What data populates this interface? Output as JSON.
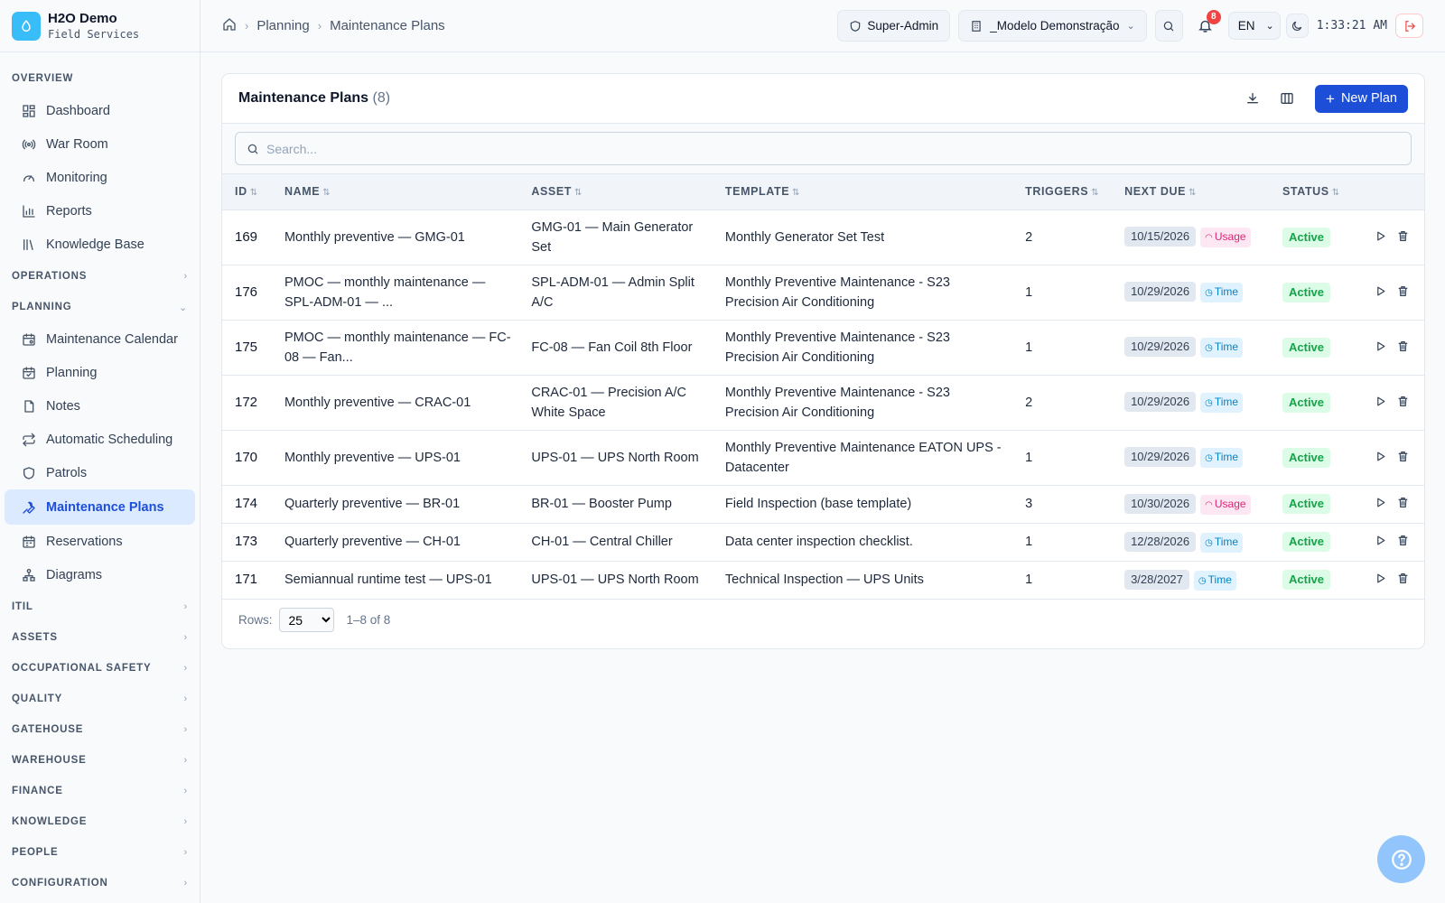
{
  "brand": {
    "title": "H2O Demo",
    "subtitle": "Field Services",
    "logo_icon": "droplet-icon"
  },
  "sidebar": {
    "overview_label": "OVERVIEW",
    "overview_items": [
      "Dashboard",
      "War Room",
      "Monitoring",
      "Reports",
      "Knowledge Base"
    ],
    "operations_label": "OPERATIONS",
    "planning_label": "PLANNING",
    "planning_items": [
      "Maintenance Calendar",
      "Planning",
      "Notes",
      "Automatic Scheduling",
      "Patrols",
      "Maintenance Plans",
      "Reservations",
      "Diagrams"
    ],
    "active_item": "Maintenance Plans",
    "collapsed_sections": [
      "ITIL",
      "ASSETS",
      "OCCUPATIONAL SAFETY",
      "QUALITY",
      "GATEHOUSE",
      "WAREHOUSE",
      "FINANCE",
      "KNOWLEDGE",
      "PEOPLE",
      "CONFIGURATION"
    ]
  },
  "header": {
    "breadcrumb": [
      "Planning",
      "Maintenance Plans"
    ],
    "role": "Super-Admin",
    "tenant": "_Modelo Demonstração",
    "notifications": "8",
    "language": "EN",
    "time": "1:33:21 AM"
  },
  "card": {
    "title": "Maintenance Plans",
    "count": "(8)",
    "new_label": "New Plan",
    "search_placeholder": "Search...",
    "columns": [
      "ID",
      "NAME",
      "ASSET",
      "TEMPLATE",
      "TRIGGERS",
      "NEXT DUE",
      "STATUS"
    ],
    "rows": [
      {
        "id": "169",
        "name": "Monthly preventive — GMG-01",
        "asset": "GMG-01 — Main Generator Set",
        "template": "Monthly Generator Set Test",
        "triggers": "2",
        "due": "10/15/2026",
        "trigger_type": "Usage",
        "status": "Active"
      },
      {
        "id": "176",
        "name": "PMOC — monthly maintenance — SPL-ADM-01 — ...",
        "asset": "SPL-ADM-01 — Admin Split A/C",
        "template": "Monthly Preventive Maintenance - S23 Precision Air Conditioning",
        "triggers": "1",
        "due": "10/29/2026",
        "trigger_type": "Time",
        "status": "Active"
      },
      {
        "id": "175",
        "name": "PMOC — monthly maintenance — FC-08 — Fan...",
        "asset": "FC-08 — Fan Coil 8th Floor",
        "template": "Monthly Preventive Maintenance - S23 Precision Air Conditioning",
        "triggers": "1",
        "due": "10/29/2026",
        "trigger_type": "Time",
        "status": "Active"
      },
      {
        "id": "172",
        "name": "Monthly preventive — CRAC-01",
        "asset": "CRAC-01 — Precision A/C White Space",
        "template": "Monthly Preventive Maintenance - S23 Precision Air Conditioning",
        "triggers": "2",
        "due": "10/29/2026",
        "trigger_type": "Time",
        "status": "Active"
      },
      {
        "id": "170",
        "name": "Monthly preventive — UPS-01",
        "asset": "UPS-01 — UPS North Room",
        "template": "Monthly Preventive Maintenance EATON UPS - Datacenter",
        "triggers": "1",
        "due": "10/29/2026",
        "trigger_type": "Time",
        "status": "Active"
      },
      {
        "id": "174",
        "name": "Quarterly preventive — BR-01",
        "asset": "BR-01 — Booster Pump",
        "template": "Field Inspection (base template)",
        "triggers": "3",
        "due": "10/30/2026",
        "trigger_type": "Usage",
        "status": "Active"
      },
      {
        "id": "173",
        "name": "Quarterly preventive — CH-01",
        "asset": "CH-01 — Central Chiller",
        "template": "Data center inspection checklist.",
        "triggers": "1",
        "due": "12/28/2026",
        "trigger_type": "Time",
        "status": "Active"
      },
      {
        "id": "171",
        "name": "Semiannual runtime test — UPS-01",
        "asset": "UPS-01 — UPS North Room",
        "template": "Technical Inspection — UPS Units",
        "triggers": "1",
        "due": "3/28/2027",
        "trigger_type": "Time",
        "status": "Active"
      }
    ],
    "rows_label": "Rows:",
    "rows_per_page": "25",
    "range": "1–8 of 8"
  },
  "colors": {
    "accent": "#1d4ed8",
    "active_bg": "#dbeafe",
    "status_green": "#16a34a",
    "usage_pink": "#db2777",
    "time_blue": "#0284c7"
  }
}
